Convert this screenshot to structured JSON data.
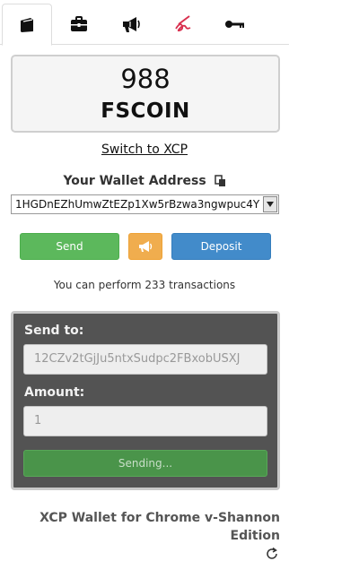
{
  "tabs": [
    {
      "name": "wallet",
      "icon": "wallet-icon",
      "active": true
    },
    {
      "name": "tools",
      "icon": "briefcase-icon",
      "active": false
    },
    {
      "name": "broadcast",
      "icon": "megaphone-icon",
      "active": false
    },
    {
      "name": "sign",
      "icon": "signature-icon",
      "active": false
    },
    {
      "name": "keys",
      "icon": "key-icon",
      "active": false
    }
  ],
  "balance": {
    "amount": "988",
    "asset": "FSCOIN"
  },
  "switch_link": "Switch to XCP",
  "wallet": {
    "label": "Your Wallet Address",
    "address": "1HGDnEZhUmwZtEZp1Xw5rBzwa3ngwpuc4Y"
  },
  "actions": {
    "send_label": "Send",
    "deposit_label": "Deposit"
  },
  "tx_info": "You can perform 233 transactions",
  "send_form": {
    "to_label": "Send to:",
    "to_value": "12CZv2tGjJu5ntxSudpc2FBxobUSXJ",
    "amount_label": "Amount:",
    "amount_value": "1",
    "submit_label": "Sending..."
  },
  "footer": {
    "title": "XCP Wallet for Chrome v-Shannon Edition"
  },
  "colors": {
    "send": "#5cb85c",
    "broadcast": "#f0ad4e",
    "deposit": "#428bca",
    "panel": "#535353",
    "sign_icon": "#d9304f"
  }
}
